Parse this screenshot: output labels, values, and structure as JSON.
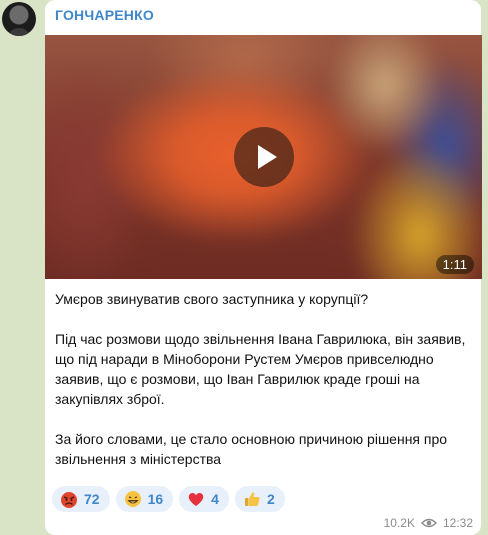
{
  "channel": {
    "name": "ГОНЧАРЕНКО"
  },
  "video": {
    "duration": "1:11"
  },
  "post": {
    "paragraphs": [
      "Умєров звинуватив свого заступника у корупції?",
      "Під час розмови щодо звільнення Івана Гаврилюка, він заявив, що під наради в Міноборони Рустем Умєров привселюдно заявив, що є розмови, що Іван Гаврилюк краде гроші на закупівлях зброї.",
      "За його словами, це стало основною причиною рішення про звільнення з міністерства"
    ]
  },
  "reactions": [
    {
      "icon": "angry-face-icon",
      "count": "72"
    },
    {
      "icon": "grinning-face-icon",
      "count": "16"
    },
    {
      "icon": "red-heart-icon",
      "count": "4"
    },
    {
      "icon": "thumbs-up-icon",
      "count": "2"
    }
  ],
  "meta": {
    "views": "10.2K",
    "time": "12:32"
  },
  "colors": {
    "accent": "#3f87c8",
    "reaction_bg": "#e8f1fb",
    "page_bg": "#d9e3c6"
  }
}
